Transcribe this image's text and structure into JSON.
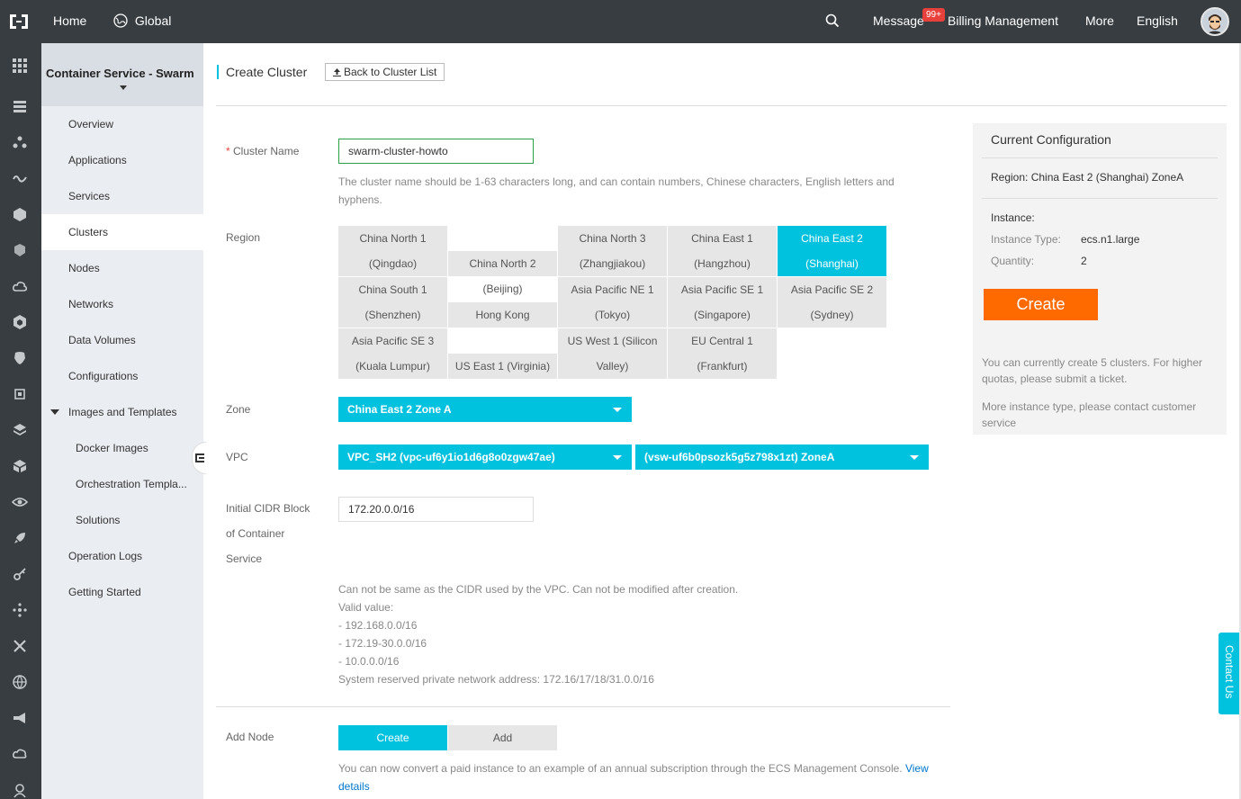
{
  "topbar": {
    "home": "Home",
    "global": "Global",
    "message": "Message",
    "message_badge": "99+",
    "billing": "Billing Management",
    "more": "More",
    "language": "English"
  },
  "rail_icons": [
    "grid-icon",
    "server-icon",
    "network-icon",
    "wave-icon",
    "cube-icon",
    "cubes-icon",
    "cloud-icon",
    "hexagon-icon",
    "shield-icon",
    "chip-icon",
    "stack-icon",
    "box-icon",
    "eye-icon",
    "rocket-icon",
    "key-icon",
    "nodes-icon",
    "cross-icon",
    "globe-icon",
    "megaphone-icon",
    "cloud-storage-icon",
    "user-icon"
  ],
  "sidebar": {
    "title": "Container Service - Swarm",
    "items": [
      {
        "label": "Overview"
      },
      {
        "label": "Applications"
      },
      {
        "label": "Services"
      },
      {
        "label": "Clusters"
      },
      {
        "label": "Nodes"
      },
      {
        "label": "Networks"
      },
      {
        "label": "Data Volumes"
      },
      {
        "label": "Configurations"
      },
      {
        "label": "Images and Templates"
      },
      {
        "label": "Docker Images"
      },
      {
        "label": "Orchestration Templa..."
      },
      {
        "label": "Solutions"
      },
      {
        "label": "Operation Logs"
      },
      {
        "label": "Getting Started"
      }
    ]
  },
  "main": {
    "title": "Create Cluster",
    "back": "Back to Cluster List",
    "cluster_name_label": "Cluster Name",
    "cluster_name_value": "swarm-cluster-howto",
    "cluster_name_help": "The cluster name should be 1-63 characters long, and can contain numbers, Chinese characters, English letters and hyphens.",
    "region_label": "Region",
    "regions": [
      {
        "l1": "China North 1",
        "l2": "(Qingdao)"
      },
      {
        "l1": "",
        "l2": "China North 2 (Beijing)"
      },
      {
        "l1": "China North 3",
        "l2": "(Zhangjiakou)"
      },
      {
        "l1": "China East 1",
        "l2": "(Hangzhou)"
      },
      {
        "l1": "China East 2",
        "l2": "(Shanghai)"
      },
      {
        "l1": "China South 1",
        "l2": "(Shenzhen)"
      },
      {
        "l1": "",
        "l2": "Hong Kong"
      },
      {
        "l1": "Asia Pacific NE 1",
        "l2": "(Tokyo)"
      },
      {
        "l1": "Asia Pacific SE 1",
        "l2": "(Singapore)"
      },
      {
        "l1": "Asia Pacific SE 2",
        "l2": "(Sydney)"
      },
      {
        "l1": "Asia Pacific SE 3",
        "l2": "(Kuala Lumpur)"
      },
      {
        "l1": "",
        "l2": "US East 1 (Virginia)"
      },
      {
        "l1": "US West 1 (Silicon",
        "l2": "Valley)"
      },
      {
        "l1": "EU Central 1",
        "l2": "(Frankfurt)"
      }
    ],
    "zone_label": "Zone",
    "zone_value": "China East 2 Zone A",
    "vpc_label": "VPC",
    "vpc_value": "VPC_SH2 (vpc-uf6y1io1d6g8o0zgw47ae)",
    "vswitch_value": "(vsw-uf6b0psozk5g5z798x1zt) ZoneA",
    "cidr_label_1": "Initial CIDR Block",
    "cidr_label_2": "of Container",
    "cidr_label_3": "Service",
    "cidr_value": "172.20.0.0/16",
    "cidr_help": [
      "Can not be same as the CIDR used by the VPC. Can not be modified after creation.",
      "Valid value:",
      "- 192.168.0.0/16",
      "- 172.19-30.0.0/16",
      "- 10.0.0.0/16",
      "System reserved private network address: 172.16/17/18/31.0.0/16"
    ],
    "add_node_label": "Add Node",
    "tab_create": "Create",
    "tab_add": "Add",
    "convert_note": "You can now convert a paid instance to an example of an annual subscription through the ECS Management Console.",
    "view_details_1": "View",
    "view_details_2": "details"
  },
  "config": {
    "title": "Current Configuration",
    "region": "Region: China East 2 (Shanghai) ZoneA",
    "instance": "Instance:",
    "instance_type_key": "Instance Type:",
    "instance_type_val": "ecs.n1.large",
    "quantity_key": "Quantity:",
    "quantity_val": "2",
    "create": "Create",
    "note1": "You can currently create 5 clusters. For higher quotas, please submit a ticket.",
    "note2": "More instance type, please contact customer service"
  },
  "contact_us": "Contact Us",
  "colors": {
    "accent": "#00c1de",
    "create": "#ff6a00",
    "topbar": "#373d41"
  }
}
